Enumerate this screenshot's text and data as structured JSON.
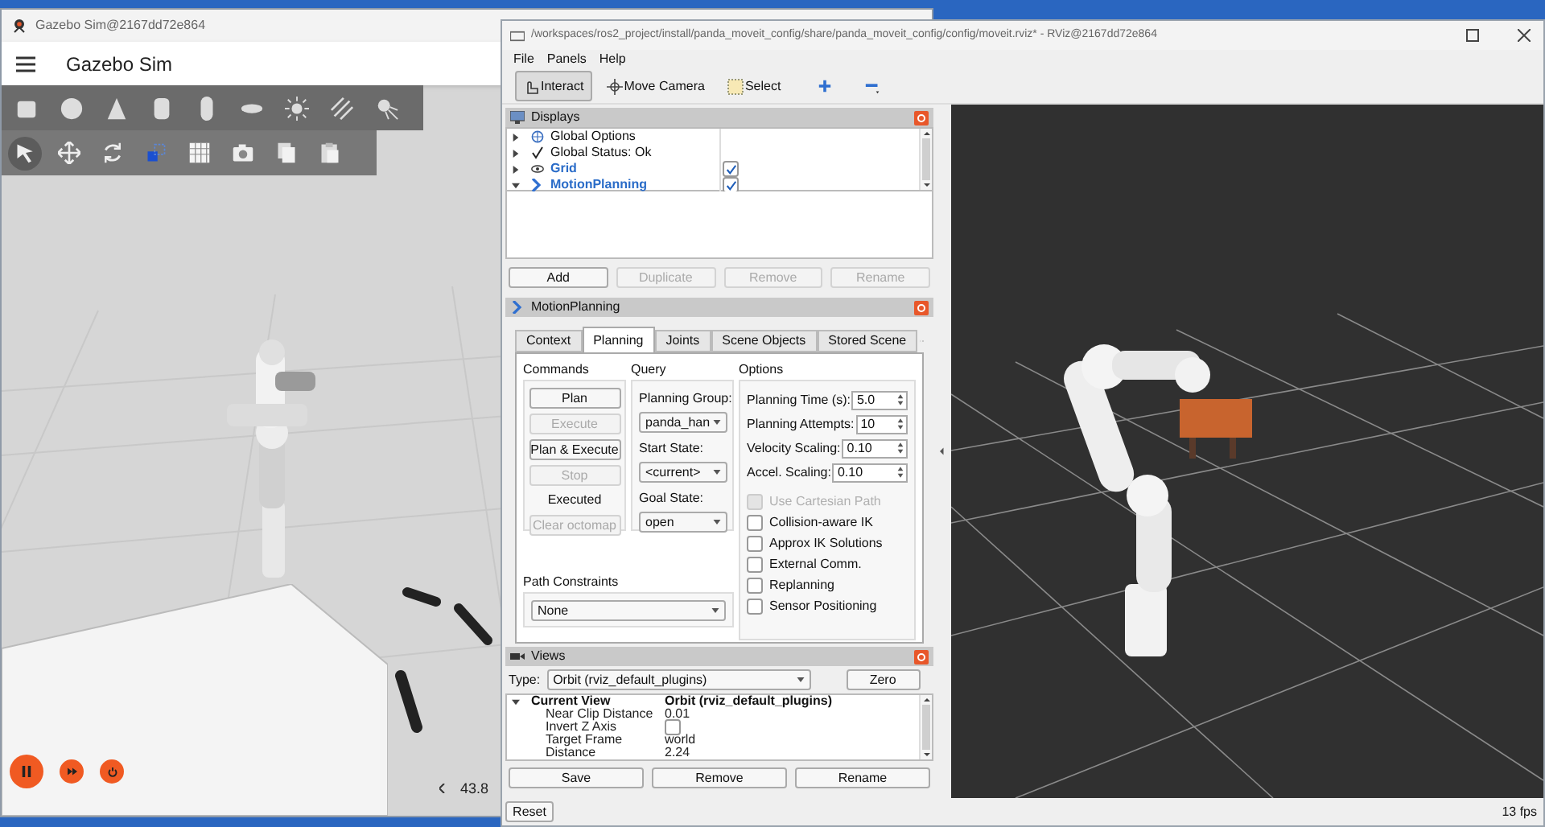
{
  "gazebo": {
    "window_title": "Gazebo Sim@2167dd72e864",
    "app_title": "Gazebo Sim",
    "transform_tools": [
      {
        "kind": "select",
        "selected": true
      },
      {
        "kind": "translate",
        "selected": false
      },
      {
        "kind": "rotate",
        "selected": false
      },
      {
        "kind": "snap",
        "selected": false
      },
      {
        "kind": "grid",
        "selected": false
      },
      {
        "kind": "camera",
        "selected": false
      },
      {
        "kind": "copy",
        "selected": false
      },
      {
        "kind": "paste",
        "selected": false
      }
    ],
    "sim_time": "43.8"
  },
  "rviz": {
    "window_title": "/workspaces/ros2_project/install/panda_moveit_config/share/panda_moveit_config/config/moveit.rviz* - RViz@2167dd72e864",
    "menu": [
      "File",
      "Panels",
      "Help"
    ],
    "tools": [
      {
        "label": "Interact",
        "kind": "interact",
        "selected": true
      },
      {
        "label": "Move Camera",
        "kind": "camera",
        "selected": false
      },
      {
        "label": "Select",
        "kind": "select",
        "selected": false
      }
    ],
    "displays": {
      "title": "Displays",
      "items": [
        {
          "label": "Global Options",
          "kind": "global",
          "expanded": false
        },
        {
          "label": "Global Status: Ok",
          "kind": "global",
          "expanded": false
        },
        {
          "label": "Grid",
          "kind": "display",
          "expanded": false,
          "checked": true
        },
        {
          "label": "MotionPlanning",
          "kind": "display",
          "expanded": true,
          "checked": true
        }
      ],
      "buttons": [
        {
          "label": "Add",
          "disabled": false
        },
        {
          "label": "Duplicate",
          "disabled": true
        },
        {
          "label": "Remove",
          "disabled": true
        },
        {
          "label": "Rename",
          "disabled": true
        }
      ]
    },
    "motion_planning": {
      "title": "MotionPlanning",
      "tabs": [
        {
          "label": "Context",
          "selected": false
        },
        {
          "label": "Planning",
          "selected": true
        },
        {
          "label": "Joints",
          "selected": false
        },
        {
          "label": "Scene Objects",
          "selected": false
        },
        {
          "label": "Stored Scene",
          "selected": false
        }
      ],
      "commands": {
        "title": "Commands",
        "items": [
          {
            "kind": "button",
            "label": "Plan",
            "disabled": false
          },
          {
            "kind": "button",
            "label": "Execute",
            "disabled": true
          },
          {
            "kind": "button",
            "label": "Plan & Execute",
            "disabled": false
          },
          {
            "kind": "button",
            "label": "Stop",
            "disabled": true
          },
          {
            "kind": "status",
            "label": "Executed"
          },
          {
            "kind": "button",
            "label": "Clear octomap",
            "disabled": true
          }
        ]
      },
      "query": {
        "title": "Query",
        "fields": [
          {
            "label": "Planning Group:",
            "value": "panda_han"
          },
          {
            "label": "Start State:",
            "value": "<current>"
          },
          {
            "label": "Goal State:",
            "value": "open"
          }
        ]
      },
      "options": {
        "title": "Options",
        "spinboxes": [
          {
            "label": "Planning Time (s):",
            "value": "5.0"
          },
          {
            "label": "Planning Attempts:",
            "value": "10"
          },
          {
            "label": "Velocity Scaling:",
            "value": "0.10"
          },
          {
            "label": "Accel. Scaling:",
            "value": "0.10"
          }
        ],
        "checkboxes": [
          {
            "label": "Use Cartesian Path",
            "checked": false,
            "disabled": true
          },
          {
            "label": "Collision-aware IK",
            "checked": false,
            "disabled": false
          },
          {
            "label": "Approx IK Solutions",
            "checked": false,
            "disabled": false
          },
          {
            "label": "External Comm.",
            "checked": false,
            "disabled": false
          },
          {
            "label": "Replanning",
            "checked": false,
            "disabled": false
          },
          {
            "label": "Sensor Positioning",
            "checked": false,
            "disabled": false
          }
        ]
      },
      "path_constraints": {
        "label": "Path Constraints",
        "value": "None"
      }
    },
    "views": {
      "title": "Views",
      "type_label": "Type:",
      "type_value": "Orbit (rviz_default_plugins)",
      "zero": "Zero",
      "rows": [
        {
          "kind": "header",
          "name": "Current View",
          "value": "Orbit (rviz_default_plugins)",
          "expanded": true
        },
        {
          "kind": "text",
          "name": "Near Clip Distance",
          "value": "0.01"
        },
        {
          "kind": "checkbox",
          "name": "Invert Z Axis",
          "checked": false
        },
        {
          "kind": "text",
          "name": "Target Frame",
          "value": "world"
        },
        {
          "kind": "text",
          "name": "Distance",
          "value": "2.24"
        }
      ],
      "buttons": [
        "Save",
        "Remove",
        "Rename"
      ]
    },
    "reset": "Reset",
    "fps": "13 fps"
  }
}
